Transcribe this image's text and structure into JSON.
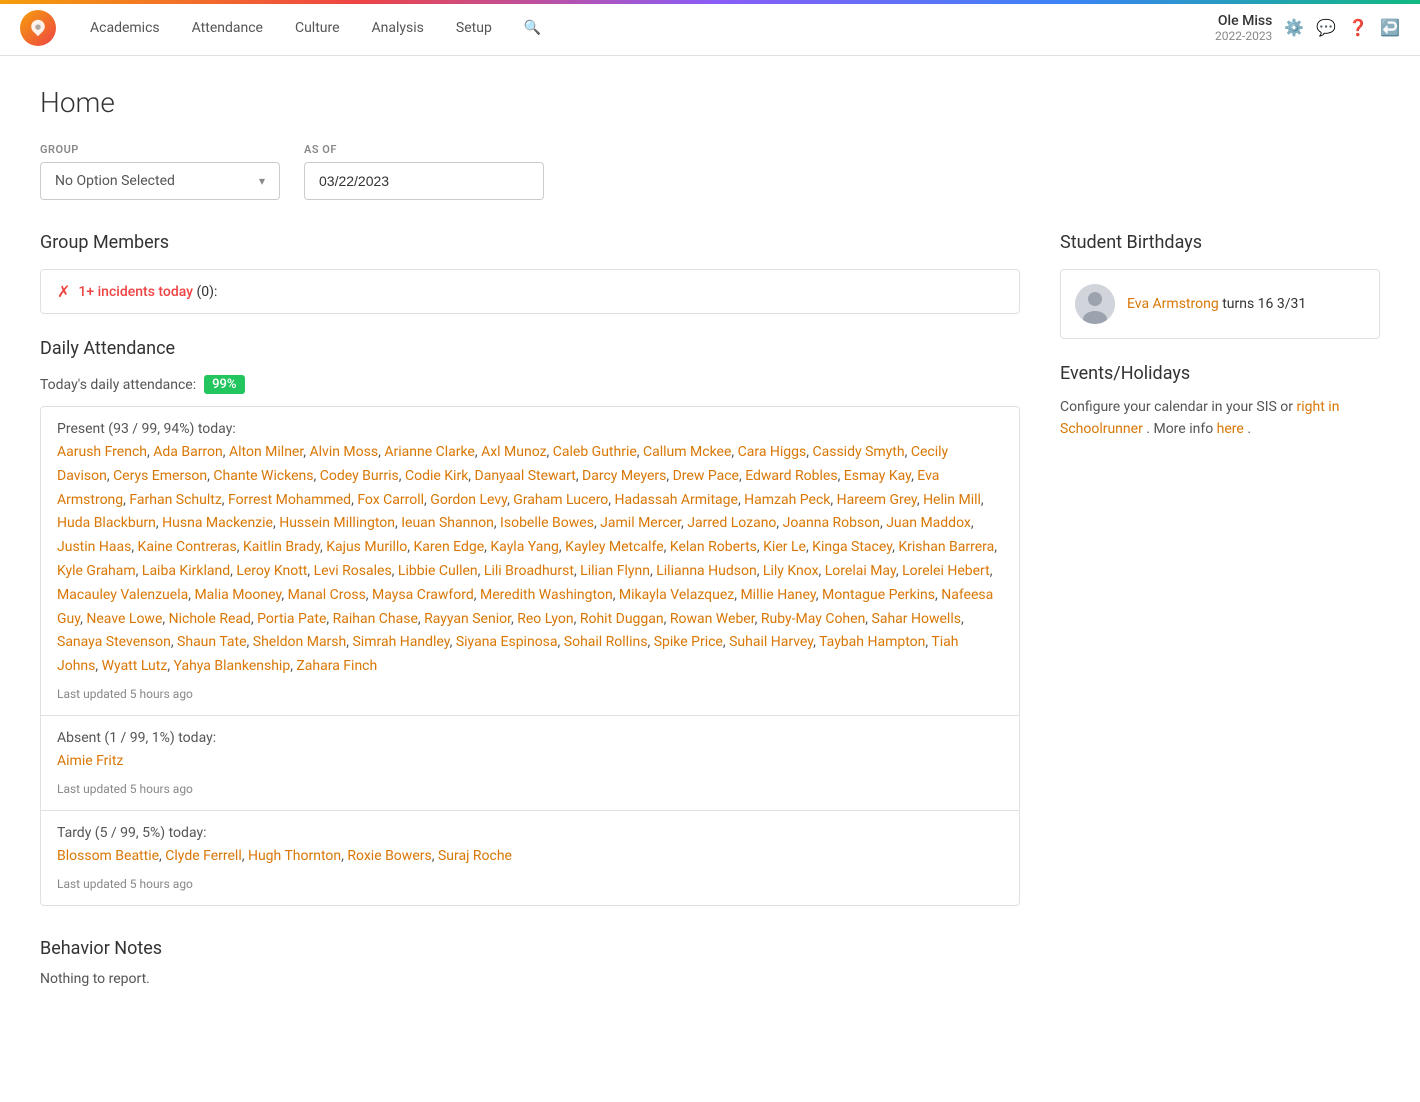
{
  "nav": {
    "links": [
      "Academics",
      "Attendance",
      "Culture",
      "Analysis",
      "Setup"
    ],
    "user_name": "Ole Miss",
    "user_year": "2022-2023"
  },
  "page": {
    "title": "Home"
  },
  "form": {
    "group_label": "GROUP",
    "group_placeholder": "No Option Selected",
    "asof_label": "AS OF",
    "asof_value": "03/22/2023"
  },
  "group_members": {
    "title": "Group Members",
    "incident_text": "1+ incidents today",
    "incident_count": "(0):"
  },
  "daily_attendance": {
    "title": "Daily Attendance",
    "today_label": "Today's daily attendance:",
    "pct": "99%",
    "present_label": "Present (93 / 99, 94%) today:",
    "present_students": [
      "Aarush French",
      "Ada Barron",
      "Alton Milner",
      "Alvin Moss",
      "Arianne Clarke",
      "Axl Munoz",
      "Caleb Guthrie",
      "Callum Mckee",
      "Cara Higgs",
      "Cassidy Smyth",
      "Cecily Davison",
      "Cerys Emerson",
      "Chante Wickens",
      "Codey Burris",
      "Codie Kirk",
      "Danyaal Stewart",
      "Darcy Meyers",
      "Drew Pace",
      "Edward Robles",
      "Esmay Kay",
      "Eva Armstrong",
      "Farhan Schultz",
      "Forrest Mohammed",
      "Fox Carroll",
      "Gordon Levy",
      "Graham Lucero",
      "Hadassah Armitage",
      "Hamzah Peck",
      "Hareem Grey",
      "Helin Mill",
      "Huda Blackburn",
      "Husna Mackenzie",
      "Hussein Millington",
      "Ieuan Shannon",
      "Isobelle Bowes",
      "Jamil Mercer",
      "Jarred Lozano",
      "Joanna Robson",
      "Juan Maddox",
      "Justin Haas",
      "Kaine Contreras",
      "Kaitlin Brady",
      "Kajus Murillo",
      "Karen Edge",
      "Kayla Yang",
      "Kayley Metcalfe",
      "Kelan Roberts",
      "Kier Le",
      "Kinga Stacey",
      "Krishan Barrera",
      "Kyle Graham",
      "Laiba Kirkland",
      "Leroy Knott",
      "Levi Rosales",
      "Libbie Cullen",
      "Lili Broadhurst",
      "Lilian Flynn",
      "Lilianna Hudson",
      "Lily Knox",
      "Lorelai May",
      "Lorelei Hebert",
      "Macauley Valenzuela",
      "Malia Mooney",
      "Manal Cross",
      "Maysa Crawford",
      "Meredith Washington",
      "Mikayla Velazquez",
      "Millie Haney",
      "Montague Perkins",
      "Nafeesa Guy",
      "Neave Lowe",
      "Nichole Read",
      "Portia Pate",
      "Raihan Chase",
      "Rayyan Senior",
      "Reo Lyon",
      "Rohit Duggan",
      "Rowan Weber",
      "Ruby-May Cohen",
      "Sahar Howells",
      "Sanaya Stevenson",
      "Shaun Tate",
      "Sheldon Marsh",
      "Simrah Handley",
      "Siyana Espinosa",
      "Sohail Rollins",
      "Spike Price",
      "Suhail Harvey",
      "Taybah Hampton",
      "Tiah Johns",
      "Wyatt Lutz",
      "Yahya Blankenship",
      "Zahara Finch"
    ],
    "present_updated": "Last updated 5 hours ago",
    "absent_label": "Absent (1 / 99, 1%) today:",
    "absent_students": [
      "Aimie Fritz"
    ],
    "absent_updated": "Last updated 5 hours ago",
    "tardy_label": "Tardy (5 / 99, 5%) today:",
    "tardy_students": [
      "Blossom Beattie",
      "Clyde Ferrell",
      "Hugh Thornton",
      "Roxie Bowers",
      "Suraj Roche"
    ],
    "tardy_updated": "Last updated 5 hours ago"
  },
  "behavior_notes": {
    "title": "Behavior Notes",
    "content": "Nothing to report."
  },
  "student_birthdays": {
    "title": "Student Birthdays",
    "student_name": "Eva Armstrong",
    "birthday_text": "turns 16 3/31"
  },
  "events_holidays": {
    "title": "Events/Holidays",
    "text_before": "Configure your calendar in your SIS or",
    "link1_text": "right in Schoolrunner",
    "text_middle": ". More info",
    "link2_text": "here",
    "text_after": "."
  }
}
